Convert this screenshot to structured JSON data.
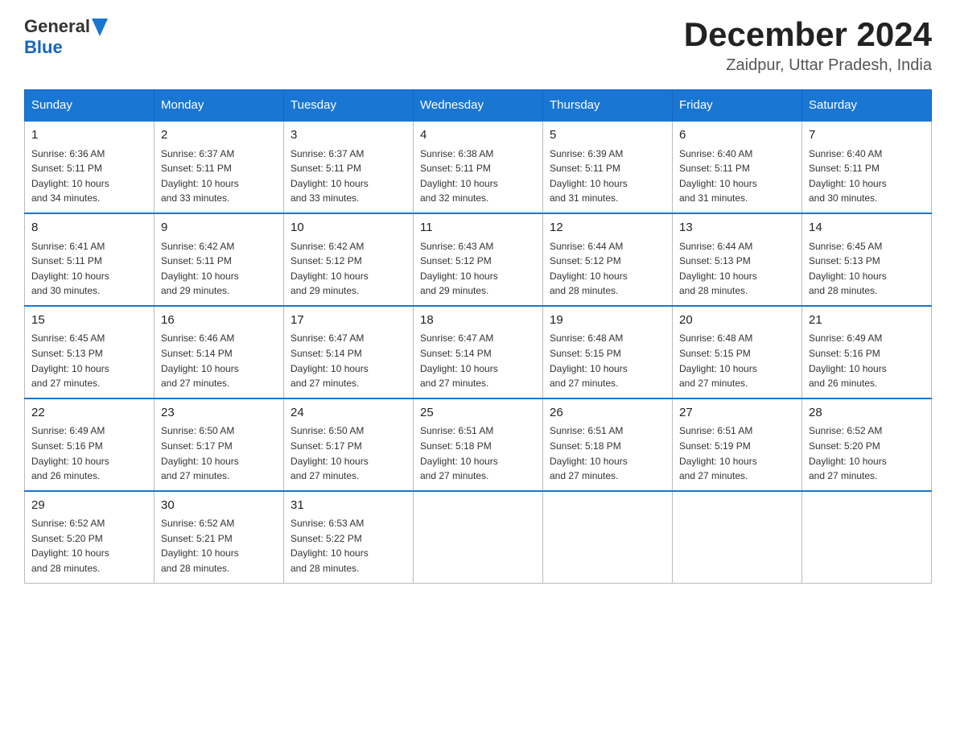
{
  "logo": {
    "text_general": "General",
    "text_blue": "Blue"
  },
  "header": {
    "month": "December 2024",
    "location": "Zaidpur, Uttar Pradesh, India"
  },
  "weekdays": [
    "Sunday",
    "Monday",
    "Tuesday",
    "Wednesday",
    "Thursday",
    "Friday",
    "Saturday"
  ],
  "weeks": [
    [
      {
        "day": "1",
        "sunrise": "6:36 AM",
        "sunset": "5:11 PM",
        "daylight": "10 hours and 34 minutes."
      },
      {
        "day": "2",
        "sunrise": "6:37 AM",
        "sunset": "5:11 PM",
        "daylight": "10 hours and 33 minutes."
      },
      {
        "day": "3",
        "sunrise": "6:37 AM",
        "sunset": "5:11 PM",
        "daylight": "10 hours and 33 minutes."
      },
      {
        "day": "4",
        "sunrise": "6:38 AM",
        "sunset": "5:11 PM",
        "daylight": "10 hours and 32 minutes."
      },
      {
        "day": "5",
        "sunrise": "6:39 AM",
        "sunset": "5:11 PM",
        "daylight": "10 hours and 31 minutes."
      },
      {
        "day": "6",
        "sunrise": "6:40 AM",
        "sunset": "5:11 PM",
        "daylight": "10 hours and 31 minutes."
      },
      {
        "day": "7",
        "sunrise": "6:40 AM",
        "sunset": "5:11 PM",
        "daylight": "10 hours and 30 minutes."
      }
    ],
    [
      {
        "day": "8",
        "sunrise": "6:41 AM",
        "sunset": "5:11 PM",
        "daylight": "10 hours and 30 minutes."
      },
      {
        "day": "9",
        "sunrise": "6:42 AM",
        "sunset": "5:11 PM",
        "daylight": "10 hours and 29 minutes."
      },
      {
        "day": "10",
        "sunrise": "6:42 AM",
        "sunset": "5:12 PM",
        "daylight": "10 hours and 29 minutes."
      },
      {
        "day": "11",
        "sunrise": "6:43 AM",
        "sunset": "5:12 PM",
        "daylight": "10 hours and 29 minutes."
      },
      {
        "day": "12",
        "sunrise": "6:44 AM",
        "sunset": "5:12 PM",
        "daylight": "10 hours and 28 minutes."
      },
      {
        "day": "13",
        "sunrise": "6:44 AM",
        "sunset": "5:13 PM",
        "daylight": "10 hours and 28 minutes."
      },
      {
        "day": "14",
        "sunrise": "6:45 AM",
        "sunset": "5:13 PM",
        "daylight": "10 hours and 28 minutes."
      }
    ],
    [
      {
        "day": "15",
        "sunrise": "6:45 AM",
        "sunset": "5:13 PM",
        "daylight": "10 hours and 27 minutes."
      },
      {
        "day": "16",
        "sunrise": "6:46 AM",
        "sunset": "5:14 PM",
        "daylight": "10 hours and 27 minutes."
      },
      {
        "day": "17",
        "sunrise": "6:47 AM",
        "sunset": "5:14 PM",
        "daylight": "10 hours and 27 minutes."
      },
      {
        "day": "18",
        "sunrise": "6:47 AM",
        "sunset": "5:14 PM",
        "daylight": "10 hours and 27 minutes."
      },
      {
        "day": "19",
        "sunrise": "6:48 AM",
        "sunset": "5:15 PM",
        "daylight": "10 hours and 27 minutes."
      },
      {
        "day": "20",
        "sunrise": "6:48 AM",
        "sunset": "5:15 PM",
        "daylight": "10 hours and 27 minutes."
      },
      {
        "day": "21",
        "sunrise": "6:49 AM",
        "sunset": "5:16 PM",
        "daylight": "10 hours and 26 minutes."
      }
    ],
    [
      {
        "day": "22",
        "sunrise": "6:49 AM",
        "sunset": "5:16 PM",
        "daylight": "10 hours and 26 minutes."
      },
      {
        "day": "23",
        "sunrise": "6:50 AM",
        "sunset": "5:17 PM",
        "daylight": "10 hours and 27 minutes."
      },
      {
        "day": "24",
        "sunrise": "6:50 AM",
        "sunset": "5:17 PM",
        "daylight": "10 hours and 27 minutes."
      },
      {
        "day": "25",
        "sunrise": "6:51 AM",
        "sunset": "5:18 PM",
        "daylight": "10 hours and 27 minutes."
      },
      {
        "day": "26",
        "sunrise": "6:51 AM",
        "sunset": "5:18 PM",
        "daylight": "10 hours and 27 minutes."
      },
      {
        "day": "27",
        "sunrise": "6:51 AM",
        "sunset": "5:19 PM",
        "daylight": "10 hours and 27 minutes."
      },
      {
        "day": "28",
        "sunrise": "6:52 AM",
        "sunset": "5:20 PM",
        "daylight": "10 hours and 27 minutes."
      }
    ],
    [
      {
        "day": "29",
        "sunrise": "6:52 AM",
        "sunset": "5:20 PM",
        "daylight": "10 hours and 28 minutes."
      },
      {
        "day": "30",
        "sunrise": "6:52 AM",
        "sunset": "5:21 PM",
        "daylight": "10 hours and 28 minutes."
      },
      {
        "day": "31",
        "sunrise": "6:53 AM",
        "sunset": "5:22 PM",
        "daylight": "10 hours and 28 minutes."
      },
      null,
      null,
      null,
      null
    ]
  ],
  "labels": {
    "sunrise": "Sunrise:",
    "sunset": "Sunset:",
    "daylight": "Daylight:"
  }
}
